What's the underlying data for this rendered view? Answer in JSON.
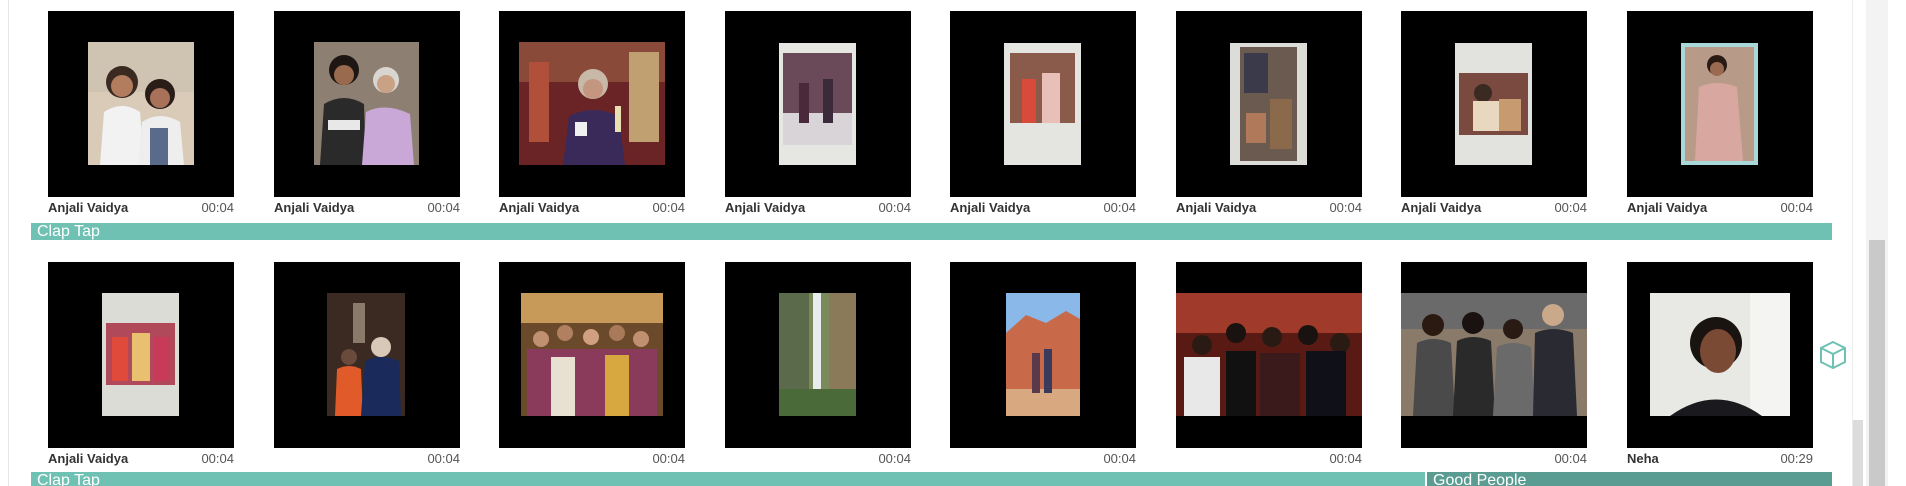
{
  "rows": [
    {
      "tiles": [
        {
          "author": "Anjali Vaidya",
          "duration": "00:04"
        },
        {
          "author": "Anjali Vaidya",
          "duration": "00:04"
        },
        {
          "author": "Anjali Vaidya",
          "duration": "00:04"
        },
        {
          "author": "Anjali Vaidya",
          "duration": "00:04"
        },
        {
          "author": "Anjali Vaidya",
          "duration": "00:04"
        },
        {
          "author": "Anjali Vaidya",
          "duration": "00:04"
        },
        {
          "author": "Anjali Vaidya",
          "duration": "00:04"
        },
        {
          "author": "Anjali Vaidya",
          "duration": "00:04"
        }
      ],
      "tracks": [
        {
          "label": "Clap Tap"
        }
      ]
    },
    {
      "tiles": [
        {
          "author": "Anjali Vaidya",
          "duration": "00:04"
        },
        {
          "author": "",
          "duration": "00:04"
        },
        {
          "author": "",
          "duration": "00:04"
        },
        {
          "author": "",
          "duration": "00:04"
        },
        {
          "author": "",
          "duration": "00:04"
        },
        {
          "author": "",
          "duration": "00:04"
        },
        {
          "author": "",
          "duration": "00:04"
        },
        {
          "author": "Neha",
          "duration": "00:29"
        }
      ],
      "tracks": [
        {
          "label": "Clap Tap"
        },
        {
          "label": "Good People"
        }
      ]
    }
  ],
  "colors": {
    "track_teal": "#6fc1b3",
    "track_dark": "#5a9c92",
    "tile_bg": "#000000",
    "cube_icon": "#6fc1b3"
  },
  "icons": {
    "side_tool": "cube-icon"
  }
}
